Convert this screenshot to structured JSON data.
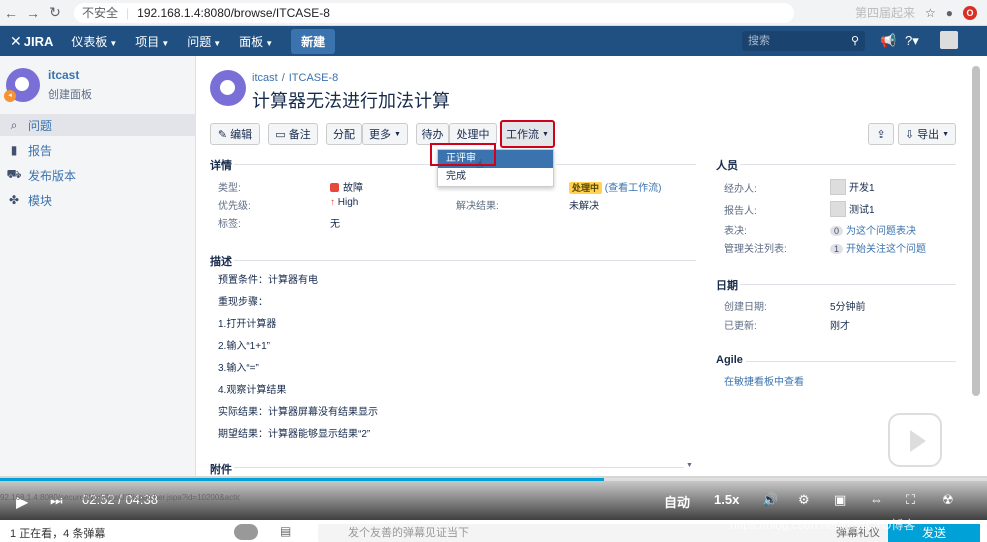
{
  "browser": {
    "insecure": "不安全",
    "url": "192.168.1.4:8080/browse/ITCASE-8",
    "overlay_text": "第四届起来"
  },
  "header": {
    "logo": "JIRA",
    "nav": [
      "仪表板",
      "项目",
      "问题",
      "面板"
    ],
    "create": "新建",
    "search_placeholder": "搜索"
  },
  "sidebar": {
    "project_name": "itcast",
    "project_sub": "创建面板",
    "items": [
      {
        "label": "问题",
        "icon": "issues-icon"
      },
      {
        "label": "报告",
        "icon": "reports-icon"
      },
      {
        "label": "发布版本",
        "icon": "releases-icon"
      },
      {
        "label": "模块",
        "icon": "components-icon"
      }
    ]
  },
  "issue": {
    "project": "itcast",
    "key": "ITCASE-8",
    "title": "计算器无法进行加法计算"
  },
  "toolbar": {
    "edit": "编辑",
    "comment": "备注",
    "assign": "分配",
    "more": "更多",
    "todo": "待办",
    "in_progress": "处理中",
    "workflow": "工作流",
    "share": "",
    "export": "导出"
  },
  "workflow_menu": {
    "items": [
      "正评审",
      "完成"
    ],
    "selected": 0
  },
  "details": {
    "heading": "详情",
    "type_label": "类型:",
    "type_value": "故障",
    "priority_label": "优先级:",
    "priority_value": "High",
    "labels_label": "标签:",
    "labels_value": "无",
    "resolution_label": "解决结果:",
    "resolution_value": "未解决",
    "status_value": "处理中",
    "status_link": "(查看工作流)"
  },
  "description": {
    "heading": "描述",
    "lines": [
      "预置条件：计算器有电",
      "重现步骤：",
      "1.打开计算器",
      "2.输入“1+1”",
      "3.输入“=”",
      "4.观察计算结果",
      "实际结果：计算器屏幕没有结果显示",
      "期望结果：计算器能够显示结果“2”"
    ]
  },
  "attachments": {
    "heading": "附件"
  },
  "people": {
    "heading": "人员",
    "assignee_label": "经办人:",
    "assignee": "开发1",
    "reporter_label": "报告人:",
    "reporter": "测试1",
    "votes_label": "表决:",
    "votes_count": "0",
    "votes_link": "为这个问题表决",
    "watchers_label": "管理关注列表:",
    "watchers_count": "1",
    "watchers_link": "开始关注这个问题"
  },
  "dates": {
    "heading": "日期",
    "created_label": "创建日期:",
    "created": "5分钟前",
    "updated_label": "已更新:",
    "updated": "刚才"
  },
  "agile": {
    "heading": "Agile",
    "link": "在敏捷看板中查看"
  },
  "video": {
    "current": "02:52",
    "total": "04:38",
    "auto": "自动",
    "speed": "1.5x",
    "progress": 0.612,
    "url_text": "92.168.1.4:8080/secure/WorkflowUIDispatcher.jspa?id=10200&action=31&atl_token=BD7U-PRMD-NGXX-0Y8Z|40b67a09bdea8310807b4eb1cd9be7c2a228042"
  },
  "comment": {
    "left_a": "正在看",
    "left_b": "条弹幕",
    "placeholder": "发个友善的弹幕见证当下",
    "etiquette": "弹幕礼仪",
    "send": "发送"
  },
  "watermark": "https://blog.csdn.net/@51CTO博客"
}
